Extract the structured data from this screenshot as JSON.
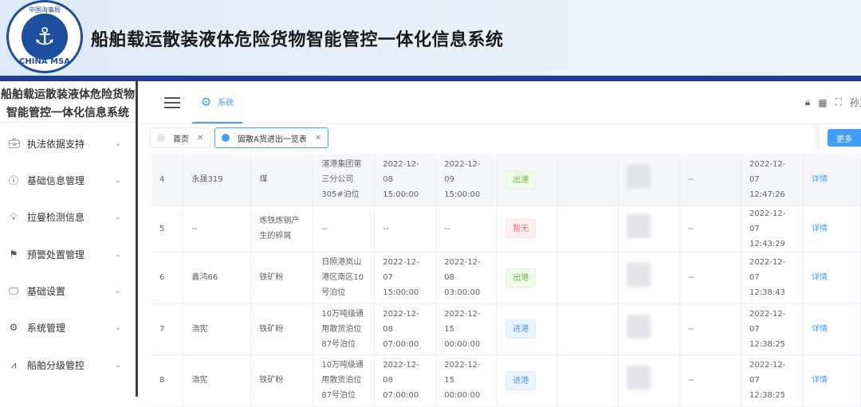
{
  "header": {
    "title": "船舶载运散装液体危险货物智能管控一体化信息系统",
    "logo_text_top": "中国海事局",
    "logo_text_bottom": "CHINA MSA"
  },
  "sidebar": {
    "title_line1": "船舶载运散装液体危险货物",
    "title_line2": "智能管控一体化信息系统",
    "items": [
      {
        "label": "执法依据支持",
        "icon": "briefcase-icon"
      },
      {
        "label": "基础信息管理",
        "icon": "info-icon"
      },
      {
        "label": "拉曼检测信息",
        "icon": "bulb-icon"
      },
      {
        "label": "预警处置管理",
        "icon": "flag-icon"
      },
      {
        "label": "基础设置",
        "icon": "monitor-icon"
      },
      {
        "label": "系统管理",
        "icon": "gear-icon"
      },
      {
        "label": "船舶分级管控",
        "icon": "chart-icon"
      }
    ]
  },
  "topbar": {
    "tab": "系统",
    "user": "孙文"
  },
  "tags": {
    "home": "首页",
    "current": "固散A货进出一览表",
    "more": "更多"
  },
  "table": {
    "rows": [
      {
        "idx": "4",
        "ship": "永晟319",
        "cargo": "煤",
        "berth": "湛港集团第三分公司305#泊位",
        "t1": "2022-12-08 15:00:00",
        "t2": "2022-12-09 15:00:00",
        "status": "出港",
        "status_type": "out",
        "c9": "--",
        "time": "2022-12-07 12:47:26",
        "action": "详情"
      },
      {
        "idx": "5",
        "ship": "--",
        "cargo": "炼铁炼钢产生的碎屑",
        "berth": "--",
        "t1": "--",
        "t2": "--",
        "status": "暂无",
        "status_type": "none",
        "c9": "--",
        "time": "2022-12-07 12:43:29",
        "action": "详情"
      },
      {
        "idx": "6",
        "ship": "鑫鸿66",
        "cargo": "铁矿粉",
        "berth": "日照港岚山港区南区10号泊位",
        "t1": "2022-12-07 15:00:00",
        "t2": "2022-12-08 03:00:00",
        "status": "出港",
        "status_type": "out",
        "c9": "--",
        "time": "2022-12-07 12:38:43",
        "action": "详情"
      },
      {
        "idx": "7",
        "ship": "浩宪",
        "cargo": "铁矿粉",
        "berth": "10万吨级通用散货泊位87号泊位",
        "t1": "2022-12-08 07:00:00",
        "t2": "2022-12-15 00:00:00",
        "status": "进港",
        "status_type": "in",
        "c9": "--",
        "time": "2022-12-07 12:38:25",
        "action": "详情"
      },
      {
        "idx": "8",
        "ship": "浩宪",
        "cargo": "铁矿粉",
        "berth": "10万吨级通用散货泊位87号泊位",
        "t1": "2022-12-08 07:00:00",
        "t2": "2022-12-15 00:00:00",
        "status": "进港",
        "status_type": "in",
        "c9": "--",
        "time": "2022-12-07 12:38:25",
        "action": "详情"
      }
    ]
  }
}
